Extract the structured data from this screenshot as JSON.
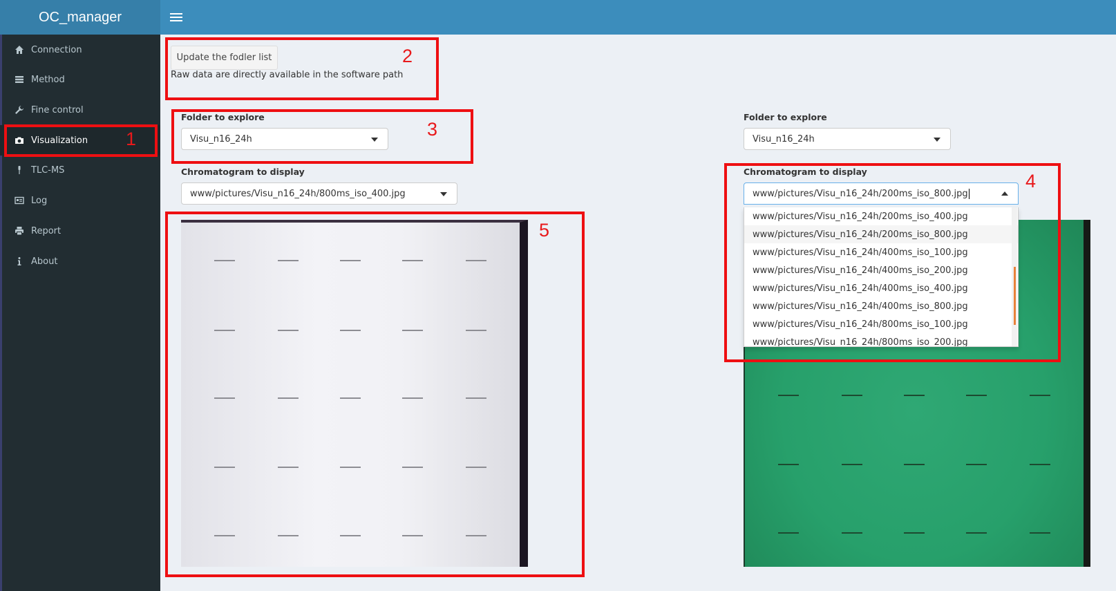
{
  "app": {
    "title": "OC_manager"
  },
  "sidebar": {
    "items": [
      {
        "label": "Connection",
        "icon": "home-icon"
      },
      {
        "label": "Method",
        "icon": "list-icon"
      },
      {
        "label": "Fine control",
        "icon": "wrench-icon"
      },
      {
        "label": "Visualization",
        "icon": "camera-icon",
        "active": true
      },
      {
        "label": "TLC-MS",
        "icon": "pin-icon"
      },
      {
        "label": "Log",
        "icon": "log-icon"
      },
      {
        "label": "Report",
        "icon": "print-icon"
      },
      {
        "label": "About",
        "icon": "info-icon"
      }
    ]
  },
  "main": {
    "update_button": "Update the fodler list",
    "note": "Raw data are directly available in the software path",
    "left": {
      "folder_label": "Folder to explore",
      "folder_value": "Visu_n16_24h",
      "chrom_label": "Chromatogram to display",
      "chrom_value": "www/pictures/Visu_n16_24h/800ms_iso_400.jpg"
    },
    "right": {
      "folder_label": "Folder to explore",
      "folder_value": "Visu_n16_24h",
      "chrom_label": "Chromatogram to display",
      "chrom_value": "www/pictures/Visu_n16_24h/200ms_iso_800.jpg",
      "options": [
        "www/pictures/Visu_n16_24h/200ms_iso_400.jpg",
        "www/pictures/Visu_n16_24h/200ms_iso_800.jpg",
        "www/pictures/Visu_n16_24h/400ms_iso_100.jpg",
        "www/pictures/Visu_n16_24h/400ms_iso_200.jpg",
        "www/pictures/Visu_n16_24h/400ms_iso_400.jpg",
        "www/pictures/Visu_n16_24h/400ms_iso_800.jpg",
        "www/pictures/Visu_n16_24h/800ms_iso_100.jpg",
        "www/pictures/Visu_n16_24h/800ms_iso_200.jpg"
      ],
      "highlighted_index": 1
    }
  },
  "annotations": [
    "1",
    "2",
    "3",
    "4",
    "5"
  ],
  "colors": {
    "header": "#3c8dbc",
    "logo_bar": "#367fa9",
    "sidebar": "#222d32",
    "annotation_red": "#ee0f12",
    "left_plate": "#f1f1f5",
    "right_plate": "#27a06b"
  }
}
